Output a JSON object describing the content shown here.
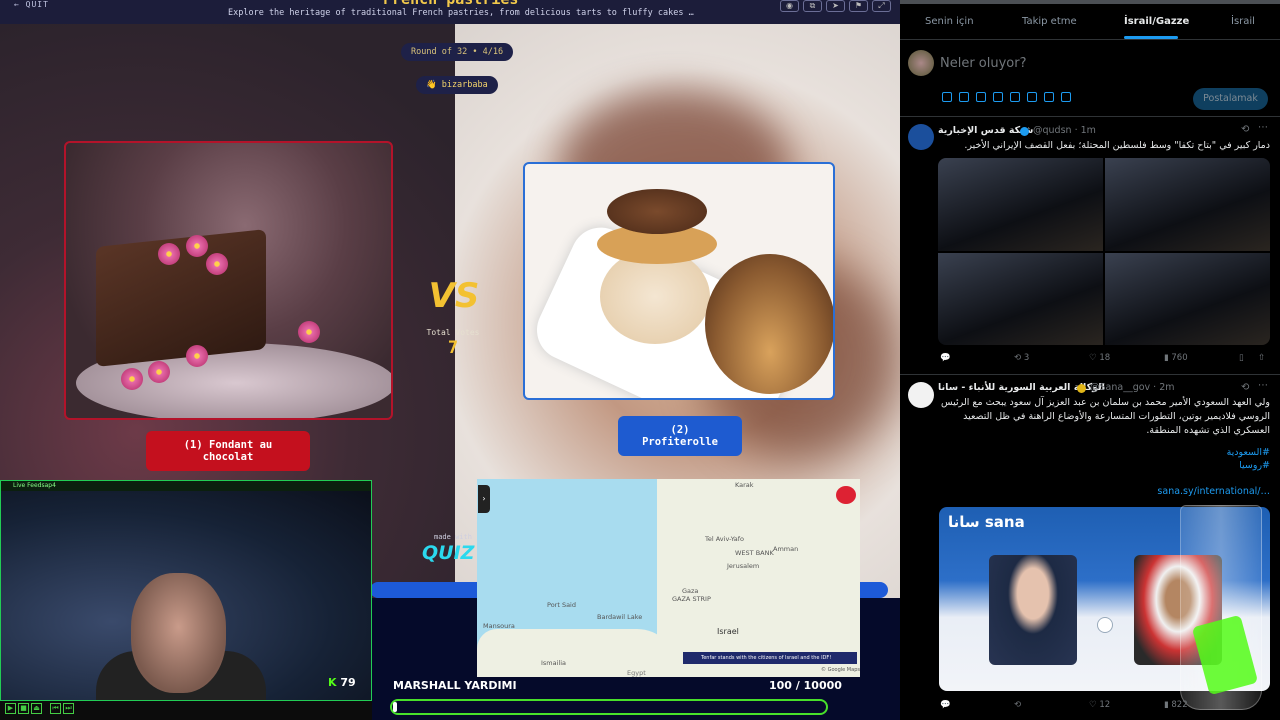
{
  "quiz": {
    "quit_label": "QUIT",
    "title": "French pastries",
    "subtitle": "Explore the heritage of traditional French pastries, from delicious tarts to fluffy cakes …",
    "round": "Round of 32 • 4/16",
    "username": "bizarbaba",
    "vs": "VS",
    "total_votes_label": "Total Votes",
    "total_votes": "7",
    "option1": "(1) Fondant au chocolat",
    "option2": "(2) Profiterolle",
    "made_with": "made with",
    "brand": "QUIZ",
    "accent_red": "#c4101e",
    "accent_blue": "#1e5bd0"
  },
  "stream": {
    "cam_title": "Live Feedsap4",
    "kick_followers": "79",
    "goal_name": "MARSHALL YARDIMI",
    "goal_count": "100 / 10000",
    "goal_progress": 0.01
  },
  "map": {
    "labels": [
      "Karak",
      "Tel Aviv-Yafo",
      "WEST BANK",
      "Amman",
      "Jerusalem",
      "Gaza",
      "GAZA STRIP",
      "Port Said",
      "Mansoura",
      "Israel",
      "Ismailia",
      "Bardawil Lake",
      "Egypt"
    ],
    "banner": "Tenfar stands with the citizens of Israel and the IDF!",
    "credit": "© Google Maps"
  },
  "twitter": {
    "tabs": [
      "Senin için",
      "Takip etme",
      "İsrail/Gazze",
      "İsrail"
    ],
    "active_tab": "İsrail/Gazze",
    "compose_placeholder": "Neler oluyor?",
    "post_button": "Postalamak",
    "tweets": [
      {
        "name": "شبكة قدس الإخبارية",
        "handle": "@qudsn · 1m",
        "text": "دمار كبير في \"بتاح تكفا\" وسط فلسطين المحتلة؛ بفعل القصف الإيراني الأخير.",
        "replies": "",
        "retweets": "3",
        "likes": "18",
        "views": "760"
      },
      {
        "name": "الوكالة العربية السورية للأنباء - سانا",
        "handle": "@Sana__gov · 2m",
        "text": "ولي العهد السعودي الأمير محمد بن سلمان بن عبد العزيز آل سعود يبحث مع الرئيس الروسي فلاديمير بوتين، التطورات المتسارعة والأوضاع الراهنة في ظل التصعيد العسكري الذي تشهده المنطقة.",
        "hashtag1": "#السعودية",
        "hashtag2": "#روسيا",
        "link": "sana.sy/international/…",
        "image_logo": "سانا sana",
        "retweets": "",
        "likes": "12",
        "views": "822"
      }
    ]
  }
}
